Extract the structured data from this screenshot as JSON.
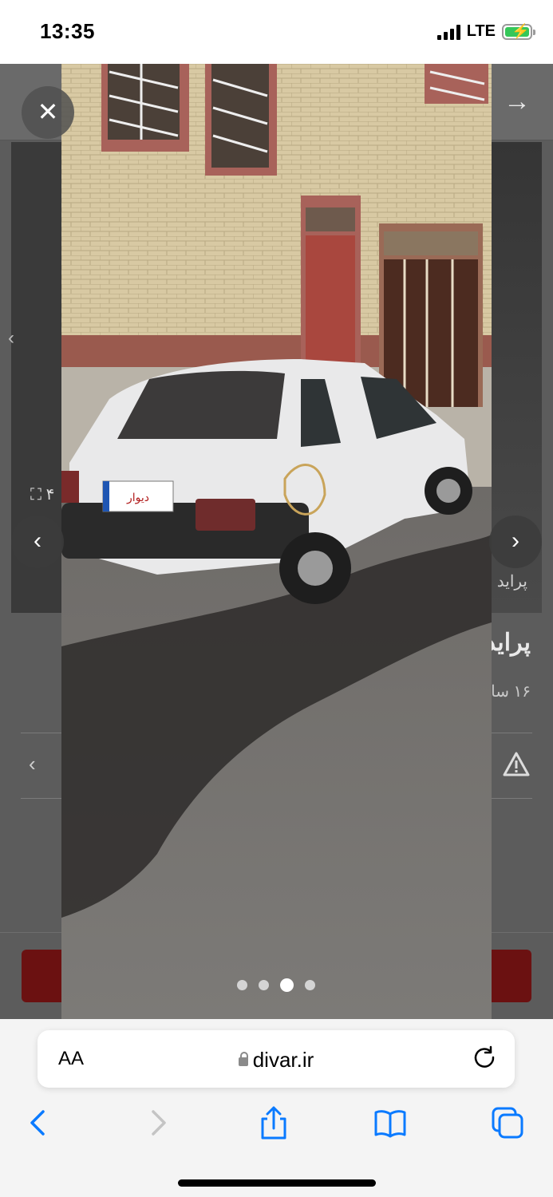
{
  "status_bar": {
    "time": "13:35",
    "network": "LTE"
  },
  "listing": {
    "breadcrumb": "پراید",
    "title": "پراید",
    "subtitle": "۱۶ سا",
    "image_counter": "۴",
    "plate_text": "دیوار"
  },
  "gallery": {
    "dot_count": 4,
    "active_index": 2,
    "close_symbol": "✕",
    "prev_symbol": "‹",
    "next_symbol": "›"
  },
  "safari": {
    "text_size_label": "AA",
    "url": "divar.ir"
  },
  "colors": {
    "brand_red": "#a51b1b",
    "ios_blue": "#0a7aff"
  }
}
